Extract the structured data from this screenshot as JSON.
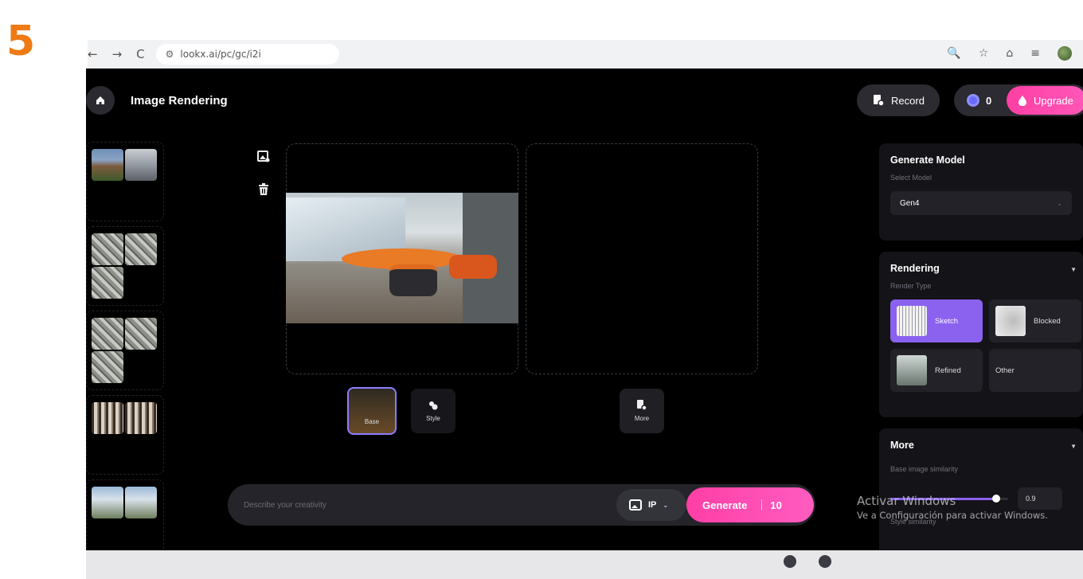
{
  "step_number": "5",
  "browser": {
    "url": "lookx.ai/pc/gc/i2i",
    "nav_back": "←",
    "nav_forward": "→",
    "nav_reload": "C",
    "site_settings_icon": "⚙",
    "zoom_icon": "🔍",
    "bookmark_icon": "☆",
    "extensions_icon": "⌂",
    "reading_list_icon": "≡"
  },
  "header": {
    "title": "Image Rendering",
    "record_label": "Record",
    "credits": "0",
    "upgrade_label": "Upgrade"
  },
  "history": {
    "groups": [
      {
        "thumbs": [
          "house",
          "street"
        ]
      },
      {
        "thumbs": [
          "city",
          "city",
          "city"
        ]
      },
      {
        "thumbs": [
          "city",
          "city",
          "city"
        ]
      },
      {
        "thumbs": [
          "facade",
          "facade"
        ]
      },
      {
        "thumbs": [
          "tower",
          "tower"
        ]
      }
    ]
  },
  "tabs": {
    "base_label": "Base",
    "style_label": "Style",
    "more_label": "More"
  },
  "prompt": {
    "placeholder": "Describe your creativity",
    "ip_label": "IP",
    "generate_label": "Generate",
    "generate_cost": "10"
  },
  "generate_model": {
    "title": "Generate Model",
    "select_label": "Select Model",
    "selected_model": "Gen4"
  },
  "rendering": {
    "title": "Rendering",
    "render_type_label": "Render Type",
    "types": [
      {
        "label": "Sketch",
        "active": true
      },
      {
        "label": "Blocked",
        "active": false
      },
      {
        "label": "Refined",
        "active": false
      },
      {
        "label": "Other",
        "active": false
      }
    ]
  },
  "more_panel": {
    "title": "More",
    "base_similarity_label": "Base image similarity",
    "base_similarity_value": 0.9,
    "base_similarity_display": "0.9",
    "style_similarity_label": "Style similarity"
  },
  "watermark": {
    "line1": "Activar Windows",
    "line2": "Ve a Configuración para activar Windows."
  },
  "colors": {
    "accent_purple": "#8b61f0",
    "accent_pink": "#ff3fa6",
    "step_orange": "#ef7a14"
  }
}
